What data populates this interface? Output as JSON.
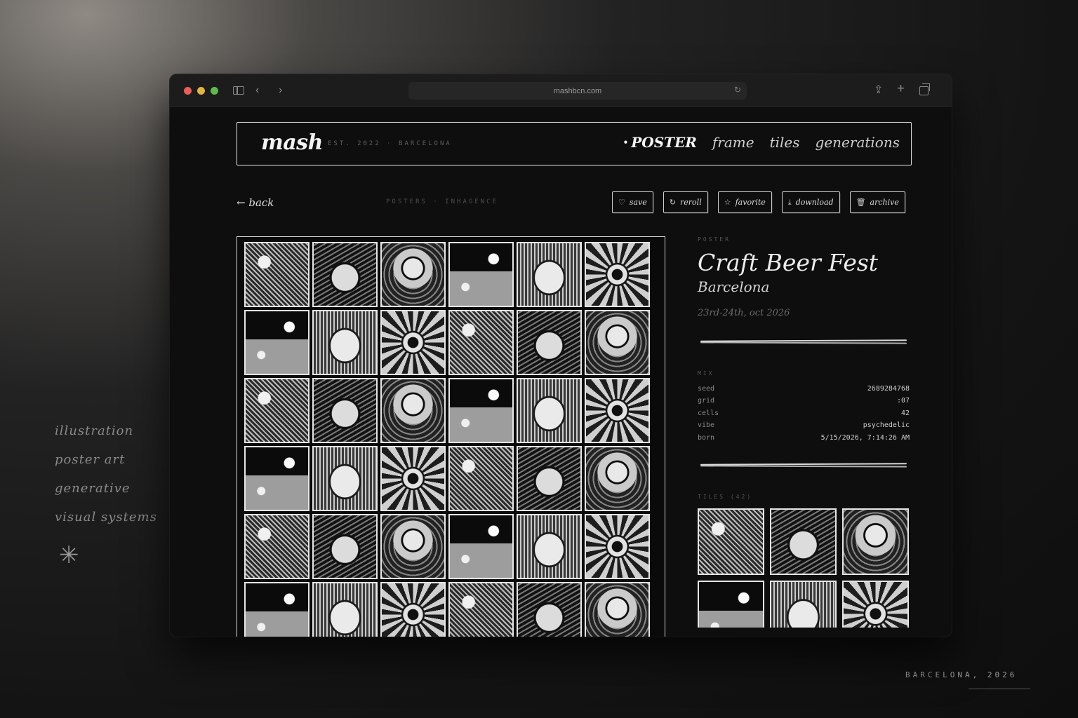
{
  "side_notes": [
    "illustration",
    "poster art",
    "generative",
    "visual systems"
  ],
  "footer_credit": "BARCELONA, 2026",
  "browser": {
    "url": "mashbcn.com"
  },
  "site": {
    "logo": "mash",
    "tagline": "EST. 2022 · BARCELONA",
    "nav": [
      {
        "label": "POSTER",
        "active": true
      },
      {
        "label": "frame",
        "active": false
      },
      {
        "label": "tiles",
        "active": false
      },
      {
        "label": "generations",
        "active": false
      }
    ]
  },
  "toolbar": {
    "back_label": "← back",
    "breadcrumb": "POSTERS · INHAGENCE",
    "actions": [
      {
        "icon": "heart-icon",
        "label": "save"
      },
      {
        "icon": "refresh-icon",
        "label": "reroll"
      },
      {
        "icon": "star-icon",
        "label": "favorite"
      },
      {
        "icon": "download-icon",
        "label": "download"
      },
      {
        "icon": "trash-icon",
        "label": "archive"
      }
    ]
  },
  "poster": {
    "kicker": "POSTER",
    "title": "Craft Beer Fest",
    "city": "Barcelona",
    "dates": "23rd-24th, oct 2026"
  },
  "mix": {
    "label": "MIX",
    "rows": [
      {
        "key": "seed",
        "value": "2689284768"
      },
      {
        "key": "grid",
        "value": ":07"
      },
      {
        "key": "cells",
        "value": "42"
      },
      {
        "key": "vibe",
        "value": "psychedelic"
      },
      {
        "key": "born",
        "value": "5/15/2026, 7:14:26 AM"
      }
    ]
  },
  "tiles": {
    "label": "TILES (42)",
    "count": 42
  },
  "colors": {
    "background": "#141414",
    "window": "#0e0e0e",
    "accent": "#e6e6e6",
    "muted": "#555555"
  }
}
